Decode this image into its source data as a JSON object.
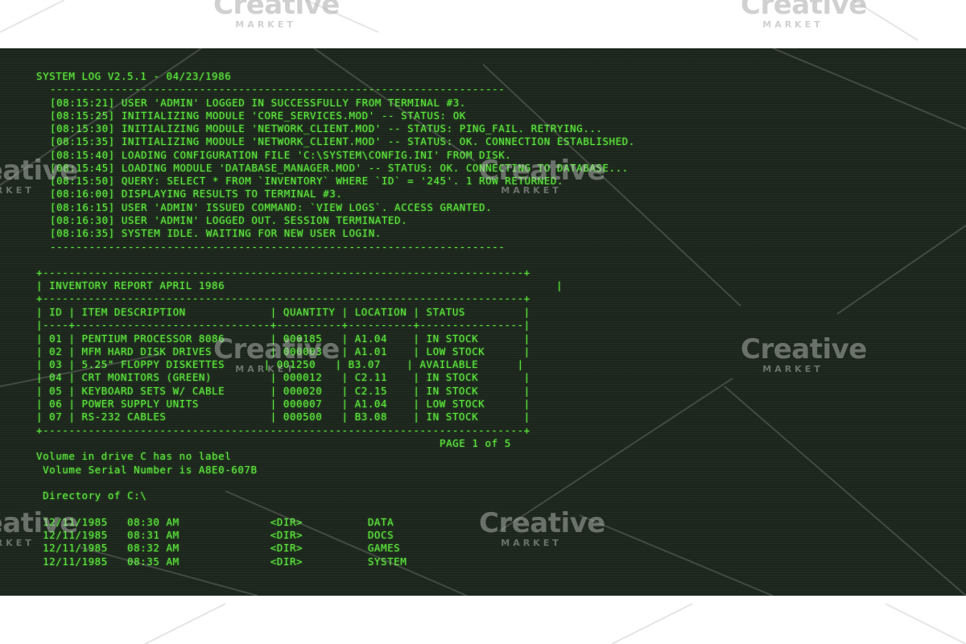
{
  "terminal": {
    "header": "SYSTEM LOG V2.5.1 - 04/23/1986",
    "rule": "----------------------------------------------------------------------",
    "log": [
      "[08:15:21] USER 'ADMIN' LOGGED IN SUCCESSFULLY FROM TERMINAL #3.",
      "[08:15:25] INITIALIZING MODULE 'CORE_SERVICES.MOD' -- STATUS: OK",
      "[08:15:30] INITIALIZING MODULE 'NETWORK_CLIENT.MOD' -- STATUS: PING_FAIL. RETRYING...",
      "[08:15:35] INITIALIZING MODULE 'NETWORK_CLIENT.MOD' -- STATUS: OK. CONNECTION ESTABLISHED.",
      "[08:15:40] LOADING CONFIGURATION FILE 'C:\\SYSTEM\\CONFIG.INI' FROM DISK.",
      "[08:15:45] LOADING MODULE 'DATABASE_MANAGER.MOD' -- STATUS: OK. CONNECTING TO DATABASE...",
      "[08:15:50] QUERY: SELECT * FROM `INVENTORY` WHERE `ID` = '245'. 1 ROW RETURNED.",
      "[08:16:00] DISPLAYING RESULTS TO TERMINAL #3.",
      "[08:16:15] USER 'ADMIN' ISSUED COMMAND: `VIEW LOGS`. ACCESS GRANTED.",
      "[08:16:30] USER 'ADMIN' LOGGED OUT. SESSION TERMINATED.",
      "[08:16:35] SYSTEM IDLE. WAITING FOR NEW USER LOGIN."
    ]
  },
  "report": {
    "border": "+--------------------------------------------------------------------------+",
    "title_row": "| INVENTORY REPORT APRIL 1986                                                   |",
    "header_row": "| ID | ITEM DESCRIPTION             | QUANTITY | LOCATION | STATUS         |",
    "separator": "|----+------------------------------+----------+----------+----------------|",
    "rows": [
      "| 01 | PENTIUM PROCESSOR 8086       | 000185   | A1.04    | IN STOCK       |",
      "| 02 | MFM HARD DISK DRIVES         | 000003   | A1.01    | LOW STOCK      |",
      "| 03 | 5.25\" FLOPPY DISKETTES      | 001250   | B3.07    | AVAILABLE      |",
      "| 04 | CRT MONITORS (GREEN)         | 000012   | C2.11    | IN STOCK       |",
      "| 05 | KEYBOARD SETS W/ CABLE       | 000020   | C2.15    | IN STOCK       |",
      "| 06 | POWER SUPPLY UNITS           | 000007   | A1.04    | LOW STOCK      |",
      "| 07 | RS-232 CABLES                | 000500   | B3.08    | IN STOCK       |"
    ],
    "page": "PAGE 1 of 5"
  },
  "dir": {
    "volume_label": "Volume in drive C has no label",
    "serial": " Volume Serial Number is A8E0-607B",
    "directory": " Directory of C:\\",
    "entries": [
      " 12/11/1985   08:30 AM              <DIR>          DATA",
      " 12/11/1985   08:31 AM              <DIR>          DOCS",
      " 12/11/1985   08:32 AM              <DIR>          GAMES",
      " 12/11/1985   08:35 AM              <DIR>          SYSTEM"
    ]
  },
  "watermark": {
    "word": "Creative",
    "sub": "MARKET"
  },
  "colors": {
    "screen_bg": "#1c251c",
    "text_green": "#5bea3a"
  }
}
